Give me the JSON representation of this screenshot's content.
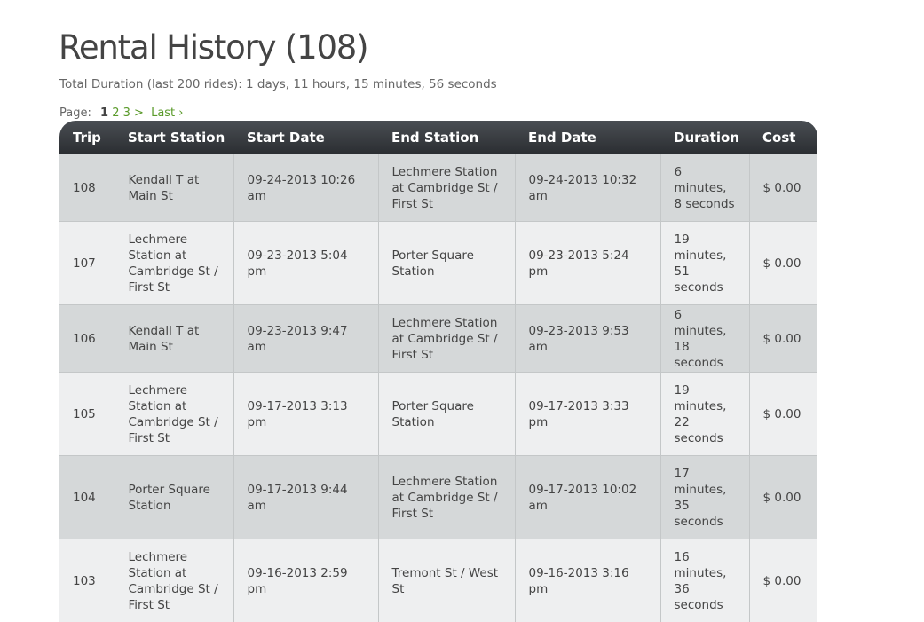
{
  "page": {
    "title": "Rental History (108)",
    "total_duration": "Total Duration (last 200 rides): 1 days, 11 hours, 15 minutes, 56 seconds"
  },
  "pagination": {
    "label": "Page:",
    "current": "1",
    "page2": "2",
    "page3": "3",
    "next": ">",
    "last": "Last ›"
  },
  "colors": {
    "link": "#5a9a2a",
    "header_bg": "#2f3236",
    "row_odd": "#d5d8d9",
    "row_even": "#eeeff0"
  },
  "table": {
    "columns": [
      "Trip",
      "Start Station",
      "Start Date",
      "End Station",
      "End Date",
      "Duration",
      "Cost"
    ],
    "rows": [
      {
        "trip": "108",
        "start_station": "Kendall T at Main St",
        "start_date": "09-24-2013 10:26 am",
        "end_station": "Lechmere Station at Cambridge St / First St",
        "end_date": "09-24-2013 10:32 am",
        "duration": "6 minutes, 8 seconds",
        "cost": "$ 0.00"
      },
      {
        "trip": "107",
        "start_station": "Lechmere Station at Cambridge St / First St",
        "start_date": "09-23-2013 5:04 pm",
        "end_station": "Porter Square Station",
        "end_date": "09-23-2013 5:24 pm",
        "duration": "19 minutes, 51 seconds",
        "cost": "$ 0.00"
      },
      {
        "trip": "106",
        "start_station": "Kendall T at Main St",
        "start_date": "09-23-2013 9:47 am",
        "end_station": "Lechmere Station at Cambridge St / First St",
        "end_date": "09-23-2013 9:53 am",
        "duration": "6 minutes, 18 seconds",
        "cost": "$ 0.00"
      },
      {
        "trip": "105",
        "start_station": "Lechmere Station at Cambridge St / First St",
        "start_date": "09-17-2013 3:13 pm",
        "end_station": "Porter Square Station",
        "end_date": "09-17-2013 3:33 pm",
        "duration": "19 minutes, 22 seconds",
        "cost": "$ 0.00"
      },
      {
        "trip": "104",
        "start_station": "Porter Square Station",
        "start_date": "09-17-2013 9:44 am",
        "end_station": "Lechmere Station at Cambridge St / First St",
        "end_date": "09-17-2013 10:02 am",
        "duration": "17 minutes, 35 seconds",
        "cost": "$ 0.00"
      },
      {
        "trip": "103",
        "start_station": "Lechmere Station at Cambridge St / First St",
        "start_date": "09-16-2013 2:59 pm",
        "end_station": "Tremont St / West St",
        "end_date": "09-16-2013 3:16 pm",
        "duration": "16 minutes, 36 seconds",
        "cost": "$ 0.00"
      }
    ]
  }
}
